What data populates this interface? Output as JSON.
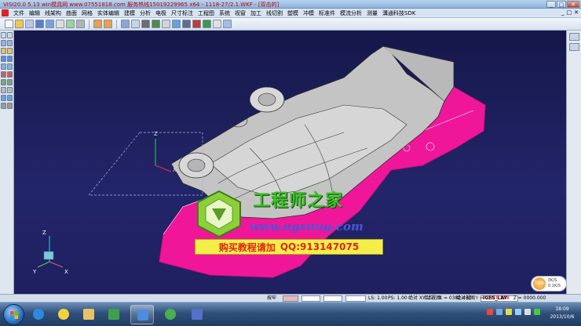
{
  "window": {
    "title": "VISI20.0 5.13 win模具网 www.07551818.com 服务热线15019229965 x64 - 1118-27/2.1.WKF - [双击的]",
    "controls": [
      "_",
      "□",
      "✕"
    ]
  },
  "menubar": {
    "items": [
      "文件",
      "编辑",
      "线架构",
      "曲面",
      "网格",
      "实体编辑",
      "建模",
      "分析",
      "电极",
      "尺寸标注",
      "工程图",
      "系统",
      "视窗",
      "加工",
      "线切割",
      "塑模",
      "冲模",
      "标准件",
      "模流分析",
      "测量",
      "溝通科技SDK"
    ],
    "right_controls": [
      "_",
      "□",
      "✕"
    ]
  },
  "viewport": {
    "axis_labels": {
      "z_upper": "Z",
      "x_upper": "X",
      "z_lower": "Z",
      "y_lower": "Y",
      "x_lower": "X"
    }
  },
  "watermark": {
    "title": "工程师之家",
    "url": "www.ugsnug.com",
    "buy": "购买教程请加",
    "qq": "QQ:913147075"
  },
  "speed_widget": {
    "percent": "74%",
    "up": "0K/S",
    "down": "0.1K/S"
  },
  "statusbar": {
    "hint": "按牢",
    "ls": "LS: 1.00",
    "ps": "PS: 1.00",
    "view_label": "绝对 XY 上视图",
    "abs_view": "绝对视图",
    "layer": "IGES_LAY",
    "unit_label": "单位:",
    "coord_x": "X = 0382.430",
    "coord_y": "Y = -0118.568",
    "coord_z": "Z = 0000.000"
  },
  "taskbar": {
    "clock_time": "18:09",
    "clock_date": "2013/10/6"
  },
  "colors": {
    "viewport_bg": "#1b1d4e",
    "part_pink": "#f0169a",
    "part_grey": "#bdbdbd",
    "watermark_green": "#3fbf2a",
    "banner_yellow": "#f4ef48"
  }
}
